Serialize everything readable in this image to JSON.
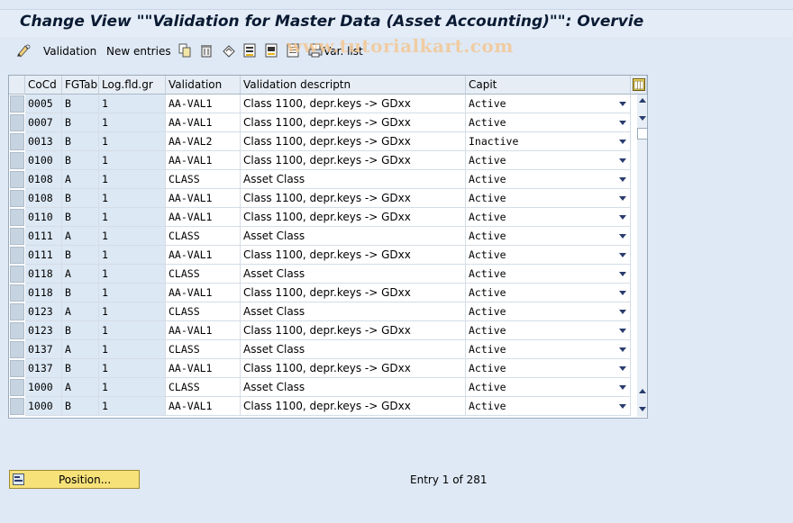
{
  "title": "Change View \"\"Validation for Master Data (Asset Accounting)\"\": Overvie",
  "watermark": "www.tutorialkart.com",
  "toolbar": {
    "validation_label": "Validation",
    "new_entries_label": "New entries",
    "var_list_label": "Var. list"
  },
  "columns": [
    "CoCd",
    "FGTab",
    "Log.fld.gr",
    "Validation",
    "Validation descriptn",
    "Capit"
  ],
  "rows": [
    {
      "cocd": "0005",
      "fgtab": "B",
      "log": "1",
      "validation": "AA-VAL1",
      "desc": "Class 1100, depr.keys -> GDxx",
      "capit": "Active"
    },
    {
      "cocd": "0007",
      "fgtab": "B",
      "log": "1",
      "validation": "AA-VAL1",
      "desc": "Class 1100, depr.keys -> GDxx",
      "capit": "Active"
    },
    {
      "cocd": "0013",
      "fgtab": "B",
      "log": "1",
      "validation": "AA-VAL2",
      "desc": "Class 1100, depr.keys -> GDxx",
      "capit": "Inactive"
    },
    {
      "cocd": "0100",
      "fgtab": "B",
      "log": "1",
      "validation": "AA-VAL1",
      "desc": "Class 1100, depr.keys -> GDxx",
      "capit": "Active"
    },
    {
      "cocd": "0108",
      "fgtab": "A",
      "log": "1",
      "validation": "CLASS",
      "desc": "Asset Class",
      "capit": "Active"
    },
    {
      "cocd": "0108",
      "fgtab": "B",
      "log": "1",
      "validation": "AA-VAL1",
      "desc": "Class 1100, depr.keys -> GDxx",
      "capit": "Active"
    },
    {
      "cocd": "0110",
      "fgtab": "B",
      "log": "1",
      "validation": "AA-VAL1",
      "desc": "Class 1100, depr.keys -> GDxx",
      "capit": "Active"
    },
    {
      "cocd": "0111",
      "fgtab": "A",
      "log": "1",
      "validation": "CLASS",
      "desc": "Asset Class",
      "capit": "Active"
    },
    {
      "cocd": "0111",
      "fgtab": "B",
      "log": "1",
      "validation": "AA-VAL1",
      "desc": "Class 1100, depr.keys -> GDxx",
      "capit": "Active"
    },
    {
      "cocd": "0118",
      "fgtab": "A",
      "log": "1",
      "validation": "CLASS",
      "desc": "Asset Class",
      "capit": "Active"
    },
    {
      "cocd": "0118",
      "fgtab": "B",
      "log": "1",
      "validation": "AA-VAL1",
      "desc": "Class 1100, depr.keys -> GDxx",
      "capit": "Active"
    },
    {
      "cocd": "0123",
      "fgtab": "A",
      "log": "1",
      "validation": "CLASS",
      "desc": "Asset Class",
      "capit": "Active"
    },
    {
      "cocd": "0123",
      "fgtab": "B",
      "log": "1",
      "validation": "AA-VAL1",
      "desc": "Class 1100, depr.keys -> GDxx",
      "capit": "Active"
    },
    {
      "cocd": "0137",
      "fgtab": "A",
      "log": "1",
      "validation": "CLASS",
      "desc": "Asset Class",
      "capit": "Active"
    },
    {
      "cocd": "0137",
      "fgtab": "B",
      "log": "1",
      "validation": "AA-VAL1",
      "desc": "Class 1100, depr.keys -> GDxx",
      "capit": "Active"
    },
    {
      "cocd": "1000",
      "fgtab": "A",
      "log": "1",
      "validation": "CLASS",
      "desc": "Asset Class",
      "capit": "Active"
    },
    {
      "cocd": "1000",
      "fgtab": "B",
      "log": "1",
      "validation": "AA-VAL1",
      "desc": "Class 1100, depr.keys -> GDxx",
      "capit": "Active"
    }
  ],
  "position_button_label": "Position...",
  "entry_text": "Entry 1 of 281",
  "colors": {
    "background": "#dfe9f5",
    "row_blue": "#dce8f4",
    "button_yellow": "#f7e27a"
  }
}
